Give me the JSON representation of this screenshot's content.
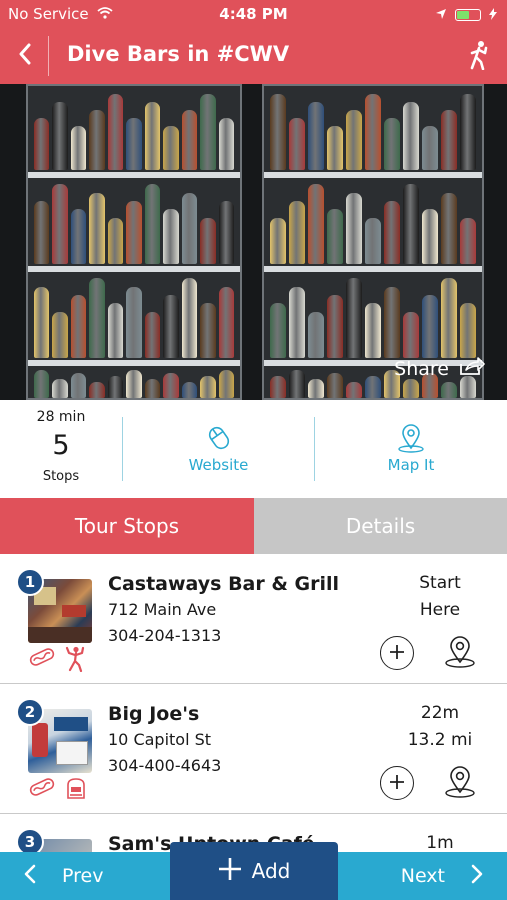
{
  "status_bar": {
    "carrier": "No Service",
    "time": "4:48 PM",
    "battery_level": 0.55
  },
  "nav": {
    "title": "Dive Bars in #CWV",
    "icons": [
      "back-chevron-icon",
      "walking-person-icon"
    ]
  },
  "hero": {
    "share_label": "Share"
  },
  "stats": {
    "duration": "28 min",
    "stop_count": "5",
    "stop_label": "Stops",
    "website_label": "Website",
    "map_label": "Map It"
  },
  "tabs": [
    {
      "label": "Tour Stops",
      "active": true
    },
    {
      "label": "Details",
      "active": false
    }
  ],
  "stops": [
    {
      "number": "1",
      "name": "Castaways Bar & Grill",
      "address": "712 Main Ave",
      "phone": "304-204-1313",
      "meta1": "Start",
      "meta2": "Here",
      "categories": [
        "hotdog-icon",
        "dancer-icon"
      ]
    },
    {
      "number": "2",
      "name": "Big Joe's",
      "address": "10 Capitol St",
      "phone": "304-400-4643",
      "meta1": "22m",
      "meta2": "13.2 mi",
      "categories": [
        "hotdog-icon",
        "jukebox-icon"
      ]
    },
    {
      "number": "3",
      "name": "Sam's Uptown Café",
      "address": "",
      "phone": "",
      "meta1": "1m",
      "meta2": "",
      "categories": []
    }
  ],
  "bottom_bar": {
    "prev_label": "Prev",
    "add_label": "Add",
    "next_label": "Next"
  },
  "colors": {
    "brand_red": "#e0515a",
    "accent_blue": "#29a9d0",
    "navy": "#1f4f86",
    "tab_inactive": "#c6c6c6"
  }
}
